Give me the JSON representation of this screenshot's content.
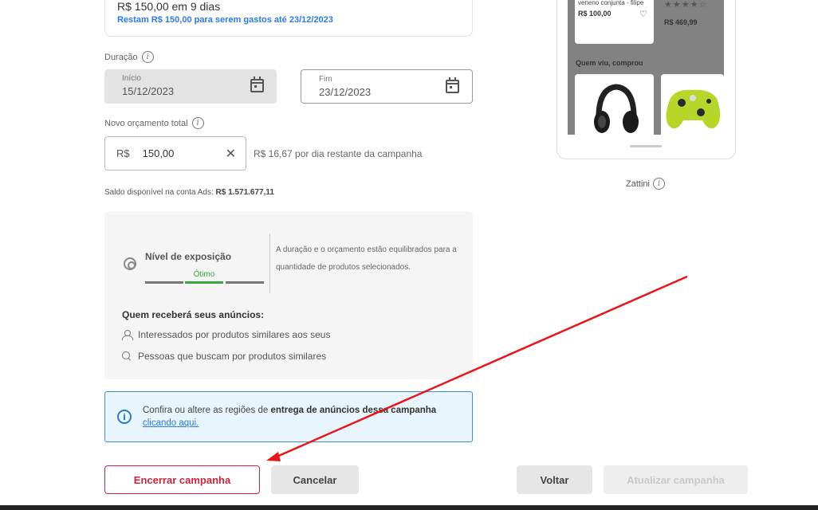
{
  "budget": {
    "main": "R$ 150,00 em 9 dias",
    "remaining": "Restam R$ 150,00 para serem gastos até 23/12/2023"
  },
  "duration": {
    "label": "Duração",
    "start_label": "Início",
    "start_value": "15/12/2023",
    "end_label": "Fim",
    "end_value": "23/12/2023"
  },
  "new_budget": {
    "label": "Novo orçamento total",
    "currency": "R$",
    "value": "150,00",
    "per_day": "R$ 16,67 por dia restante da campanha"
  },
  "saldo": {
    "label": "Saldo disponível na conta Ads:",
    "value": "R$ 1.571.677,11"
  },
  "exposure": {
    "title": "Nível de exposição",
    "level": "Ótimo",
    "description": "A duração e o orçamento estão equilibrados para a quantidade de produtos selecionados."
  },
  "receivers": {
    "title": "Quem receberá seus anúncios:",
    "items": [
      "Interessados por produtos similares aos seus",
      "Pessoas que buscam por produtos similares"
    ]
  },
  "banner": {
    "text_before": "Confira ou altere as regiões de ",
    "text_bold": "entrega de anúncios dessa campanha",
    "link": "clicando aqui."
  },
  "buttons": {
    "end": "Encerrar campanha",
    "cancel": "Cancelar",
    "back": "Voltar",
    "update": "Atualizar campanha"
  },
  "preview": {
    "product_name": "veneno conjunta - filipe",
    "product_price": "R$ 100,00",
    "product2_price": "R$ 469,99",
    "seen_title": "Quem viu, comprou",
    "store": "Zattini"
  },
  "colors": {
    "accent_blue": "#2b7be4",
    "danger_red": "#d3263d",
    "success_green": "#3aa640",
    "annotation_arrow": "#e8161b"
  }
}
